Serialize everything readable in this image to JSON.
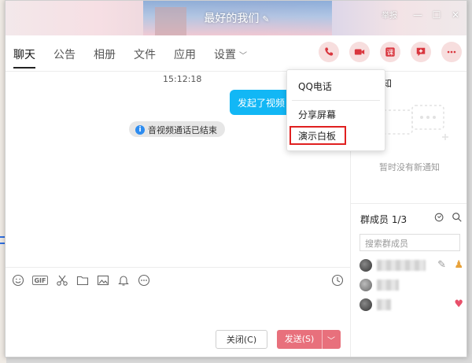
{
  "window": {
    "title": "最好的我们",
    "title_edit_icon": "edit-icon",
    "title_right_text": "举报"
  },
  "tabs": [
    {
      "label": "聊天",
      "active": true
    },
    {
      "label": "公告",
      "active": false
    },
    {
      "label": "相册",
      "active": false
    },
    {
      "label": "文件",
      "active": false
    },
    {
      "label": "应用",
      "active": false
    },
    {
      "label": "设置",
      "active": false
    }
  ],
  "actions": [
    {
      "icon": "phone-icon"
    },
    {
      "icon": "video-call-icon"
    },
    {
      "icon": "class-icon",
      "glyph": "课"
    },
    {
      "icon": "chat-add-icon"
    },
    {
      "icon": "more-icon"
    }
  ],
  "dropdown": {
    "items": [
      "QQ电话",
      "分享屏幕",
      "演示白板"
    ],
    "highlighted": "演示白板"
  },
  "chat": {
    "time": "15:12:18",
    "bubble_text": "发起了视频",
    "system_msg": "音视频通话已结束"
  },
  "toolbar": {
    "tools": [
      "emoji-icon",
      "gif-icon",
      "scissors-icon",
      "folder-icon",
      "image-icon",
      "bell-icon",
      "more-circle-icon"
    ],
    "gif_label": "GIF",
    "history_icon": "clock-icon"
  },
  "buttons": {
    "close_label": "关闭(C)",
    "send_label": "发送(S)"
  },
  "notice": {
    "title": "知",
    "empty_text": "暂时没有新通知"
  },
  "members": {
    "title": "群成员 1/3",
    "search_placeholder": "搜索群成员"
  },
  "colors": {
    "accent": "#d9363e",
    "bubble": "#12b7f5",
    "send_button": "#e8707c",
    "highlight_box": "#e02020"
  }
}
